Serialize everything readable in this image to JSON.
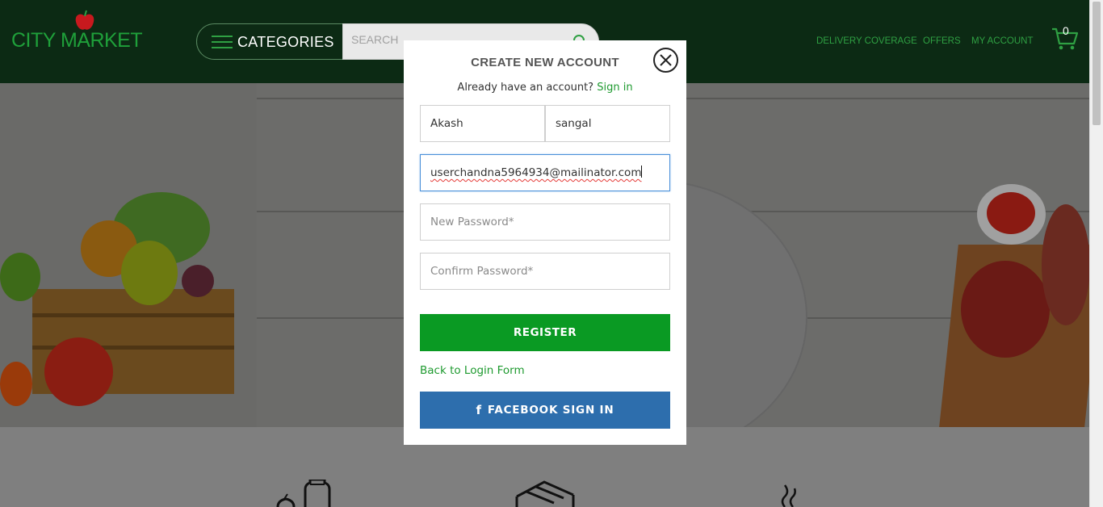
{
  "header": {
    "logo_text": "CITY MARKET",
    "categories_label": "CATEGORIES",
    "search_placeholder": "SEARCH",
    "nav": [
      {
        "label": "DELIVERY COVERAGE"
      },
      {
        "label": "OFFERS"
      },
      {
        "label": "MY ACCOUNT"
      }
    ],
    "cart_count": "0"
  },
  "modal": {
    "title": "CREATE NEW ACCOUNT",
    "have_account_text": "Already have an account?",
    "signin_label": "Sign in",
    "first_name_value": "Akash",
    "last_name_value": "sangal",
    "email_value": "userchandna5964934@mailinator.com",
    "new_password_placeholder": "New Password*",
    "confirm_password_placeholder": "Confirm Password*",
    "register_label": "REGISTER",
    "back_label": "Back to Login Form",
    "facebook_label": "FACEBOOK SIGN IN"
  },
  "colors": {
    "header_bg": "#0c2a14",
    "brand_green": "#1e9a2f",
    "register_green": "#0a9a23",
    "facebook_blue": "#2d6ead"
  }
}
